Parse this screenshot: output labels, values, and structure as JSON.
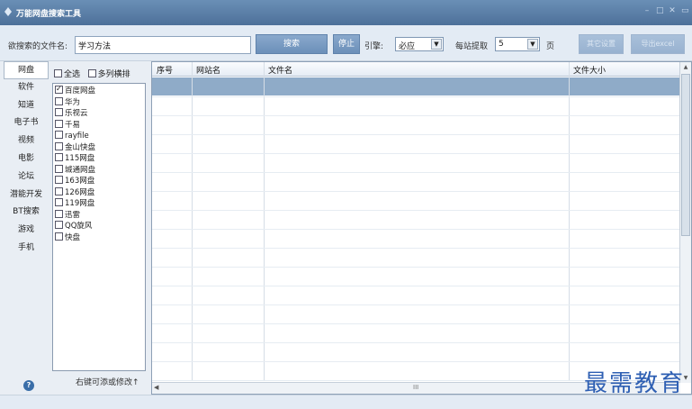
{
  "window": {
    "title": "万能网盘搜索工具"
  },
  "toolbar": {
    "search_label": "欲搜索的文件名:",
    "search_value": "学习方法",
    "search_button": "搜索",
    "stop_button": "停止",
    "engine_label": "引擎:",
    "engine_value": "必应",
    "per_site_label": "每站提取",
    "per_site_value": "5",
    "page_unit": "页",
    "other_settings_button": "其它设置",
    "export_excel_button": "导出excel"
  },
  "categories": [
    "网盘",
    "软件",
    "知道",
    "电子书",
    "视频",
    "电影",
    "论坛",
    "潜能开发",
    "BT搜索",
    "游戏",
    "手机"
  ],
  "sites": {
    "select_all_label": "全选",
    "multi_column_label": "多列横排",
    "items": [
      {
        "name": "百度网盘",
        "checked": true
      },
      {
        "name": "华为",
        "checked": false
      },
      {
        "name": "乐视云",
        "checked": false
      },
      {
        "name": "千易",
        "checked": false
      },
      {
        "name": "rayfile",
        "checked": false
      },
      {
        "name": "金山快盘",
        "checked": false
      },
      {
        "name": "115网盘",
        "checked": false
      },
      {
        "name": "城通网盘",
        "checked": false
      },
      {
        "name": "163网盘",
        "checked": false
      },
      {
        "name": "126网盘",
        "checked": false
      },
      {
        "name": "119网盘",
        "checked": false
      },
      {
        "name": "迅雷",
        "checked": false
      },
      {
        "name": "QQ旋风",
        "checked": false
      },
      {
        "name": "快盘",
        "checked": false
      }
    ],
    "footer_hint": "右键可添或修改↑"
  },
  "results": {
    "columns": [
      "序号",
      "网站名",
      "文件名",
      "文件大小"
    ]
  },
  "watermark": "最需教育",
  "colors": {
    "titlebar": "#5a7ea6",
    "selected_row": "#8fabc8",
    "watermark": "#2e5fb3"
  }
}
